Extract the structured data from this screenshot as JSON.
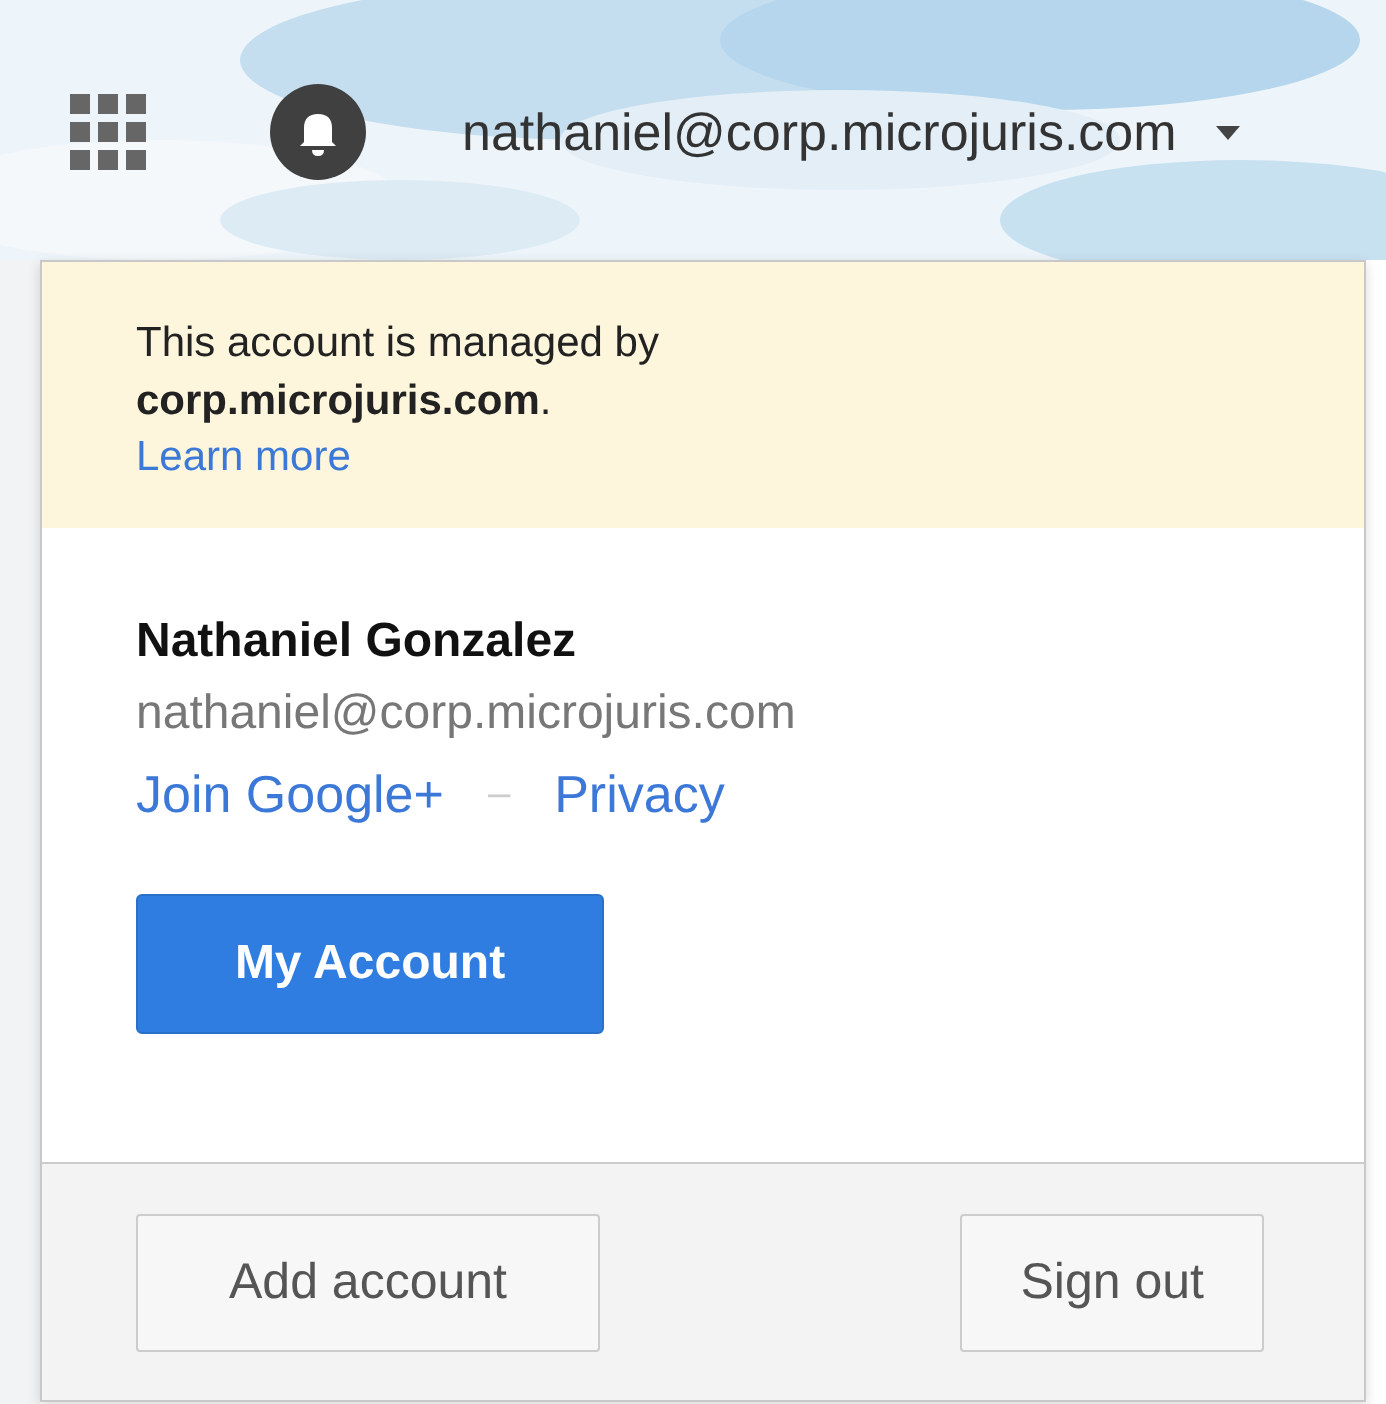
{
  "header": {
    "account": "nathaniel@corp.microjuris.com"
  },
  "notice": {
    "text": "This account is managed by **corp.microjuris.com**.",
    "link": "Learn more"
  },
  "profile": {
    "name": "Nathaniel Gonzalez",
    "email": "nathaniel@corp.microjuris.com",
    "links": [
      "Join Google+",
      "Privacy"
    ],
    "separator": "–"
  },
  "primary_button": "My Account",
  "footer_buttons": [
    "Add account",
    "Sign out"
  ]
}
